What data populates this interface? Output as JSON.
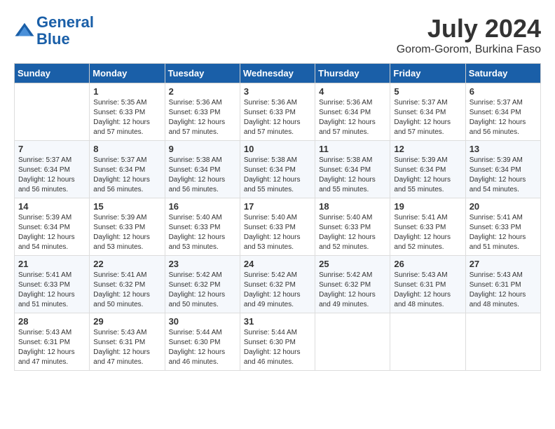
{
  "logo": {
    "line1": "General",
    "line2": "Blue"
  },
  "title": "July 2024",
  "location": "Gorom-Gorom, Burkina Faso",
  "columns": [
    "Sunday",
    "Monday",
    "Tuesday",
    "Wednesday",
    "Thursday",
    "Friday",
    "Saturday"
  ],
  "weeks": [
    [
      {
        "day": "",
        "info": ""
      },
      {
        "day": "1",
        "info": "Sunrise: 5:35 AM\nSunset: 6:33 PM\nDaylight: 12 hours\nand 57 minutes."
      },
      {
        "day": "2",
        "info": "Sunrise: 5:36 AM\nSunset: 6:33 PM\nDaylight: 12 hours\nand 57 minutes."
      },
      {
        "day": "3",
        "info": "Sunrise: 5:36 AM\nSunset: 6:33 PM\nDaylight: 12 hours\nand 57 minutes."
      },
      {
        "day": "4",
        "info": "Sunrise: 5:36 AM\nSunset: 6:34 PM\nDaylight: 12 hours\nand 57 minutes."
      },
      {
        "day": "5",
        "info": "Sunrise: 5:37 AM\nSunset: 6:34 PM\nDaylight: 12 hours\nand 57 minutes."
      },
      {
        "day": "6",
        "info": "Sunrise: 5:37 AM\nSunset: 6:34 PM\nDaylight: 12 hours\nand 56 minutes."
      }
    ],
    [
      {
        "day": "7",
        "info": "Sunrise: 5:37 AM\nSunset: 6:34 PM\nDaylight: 12 hours\nand 56 minutes."
      },
      {
        "day": "8",
        "info": "Sunrise: 5:37 AM\nSunset: 6:34 PM\nDaylight: 12 hours\nand 56 minutes."
      },
      {
        "day": "9",
        "info": "Sunrise: 5:38 AM\nSunset: 6:34 PM\nDaylight: 12 hours\nand 56 minutes."
      },
      {
        "day": "10",
        "info": "Sunrise: 5:38 AM\nSunset: 6:34 PM\nDaylight: 12 hours\nand 55 minutes."
      },
      {
        "day": "11",
        "info": "Sunrise: 5:38 AM\nSunset: 6:34 PM\nDaylight: 12 hours\nand 55 minutes."
      },
      {
        "day": "12",
        "info": "Sunrise: 5:39 AM\nSunset: 6:34 PM\nDaylight: 12 hours\nand 55 minutes."
      },
      {
        "day": "13",
        "info": "Sunrise: 5:39 AM\nSunset: 6:34 PM\nDaylight: 12 hours\nand 54 minutes."
      }
    ],
    [
      {
        "day": "14",
        "info": "Sunrise: 5:39 AM\nSunset: 6:34 PM\nDaylight: 12 hours\nand 54 minutes."
      },
      {
        "day": "15",
        "info": "Sunrise: 5:39 AM\nSunset: 6:33 PM\nDaylight: 12 hours\nand 53 minutes."
      },
      {
        "day": "16",
        "info": "Sunrise: 5:40 AM\nSunset: 6:33 PM\nDaylight: 12 hours\nand 53 minutes."
      },
      {
        "day": "17",
        "info": "Sunrise: 5:40 AM\nSunset: 6:33 PM\nDaylight: 12 hours\nand 53 minutes."
      },
      {
        "day": "18",
        "info": "Sunrise: 5:40 AM\nSunset: 6:33 PM\nDaylight: 12 hours\nand 52 minutes."
      },
      {
        "day": "19",
        "info": "Sunrise: 5:41 AM\nSunset: 6:33 PM\nDaylight: 12 hours\nand 52 minutes."
      },
      {
        "day": "20",
        "info": "Sunrise: 5:41 AM\nSunset: 6:33 PM\nDaylight: 12 hours\nand 51 minutes."
      }
    ],
    [
      {
        "day": "21",
        "info": "Sunrise: 5:41 AM\nSunset: 6:33 PM\nDaylight: 12 hours\nand 51 minutes."
      },
      {
        "day": "22",
        "info": "Sunrise: 5:41 AM\nSunset: 6:32 PM\nDaylight: 12 hours\nand 50 minutes."
      },
      {
        "day": "23",
        "info": "Sunrise: 5:42 AM\nSunset: 6:32 PM\nDaylight: 12 hours\nand 50 minutes."
      },
      {
        "day": "24",
        "info": "Sunrise: 5:42 AM\nSunset: 6:32 PM\nDaylight: 12 hours\nand 49 minutes."
      },
      {
        "day": "25",
        "info": "Sunrise: 5:42 AM\nSunset: 6:32 PM\nDaylight: 12 hours\nand 49 minutes."
      },
      {
        "day": "26",
        "info": "Sunrise: 5:43 AM\nSunset: 6:31 PM\nDaylight: 12 hours\nand 48 minutes."
      },
      {
        "day": "27",
        "info": "Sunrise: 5:43 AM\nSunset: 6:31 PM\nDaylight: 12 hours\nand 48 minutes."
      }
    ],
    [
      {
        "day": "28",
        "info": "Sunrise: 5:43 AM\nSunset: 6:31 PM\nDaylight: 12 hours\nand 47 minutes."
      },
      {
        "day": "29",
        "info": "Sunrise: 5:43 AM\nSunset: 6:31 PM\nDaylight: 12 hours\nand 47 minutes."
      },
      {
        "day": "30",
        "info": "Sunrise: 5:44 AM\nSunset: 6:30 PM\nDaylight: 12 hours\nand 46 minutes."
      },
      {
        "day": "31",
        "info": "Sunrise: 5:44 AM\nSunset: 6:30 PM\nDaylight: 12 hours\nand 46 minutes."
      },
      {
        "day": "",
        "info": ""
      },
      {
        "day": "",
        "info": ""
      },
      {
        "day": "",
        "info": ""
      }
    ]
  ]
}
